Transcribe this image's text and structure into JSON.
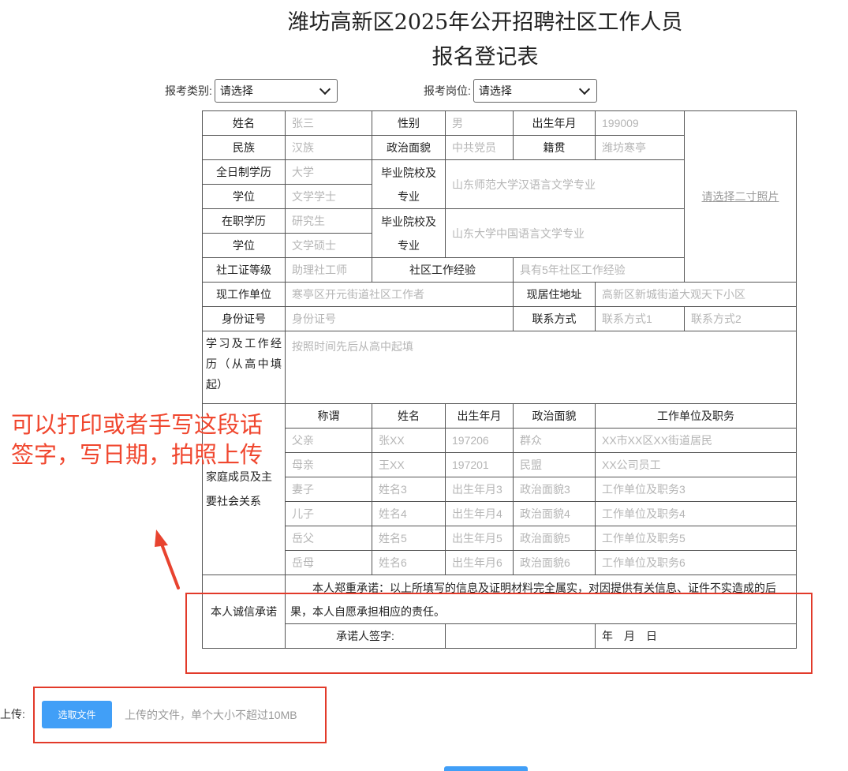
{
  "header": {
    "title_line1": "潍坊高新区2025年公开招聘社区工作人员",
    "title_line2": "报名登记表"
  },
  "selects": {
    "category_label": "报考类别:",
    "category_value": "请选择",
    "position_label": "报考岗位:",
    "position_value": "请选择"
  },
  "form": {
    "name_label": "姓名",
    "name_ph": "张三",
    "gender_label": "性别",
    "gender_ph": "男",
    "birth_label": "出生年月",
    "birth_ph": "199009",
    "ethnic_label": "民族",
    "ethnic_ph": "汉族",
    "political_label": "政治面貌",
    "political_ph": "中共党员",
    "native_label": "籍贯",
    "native_ph": "潍坊寒亭",
    "fulltime_edu_label": "全日制学历",
    "fulltime_edu_ph": "大学",
    "school_label": "毕业院校及专业",
    "fulltime_school_ph": "山东师范大学汉语言文学专业",
    "degree_label": "学位",
    "fulltime_degree_ph": "文学学士",
    "parttime_edu_label": "在职学历",
    "parttime_edu_ph": "研究生",
    "parttime_school_ph": "山东大学中国语言文学专业",
    "parttime_degree_ph": "文学硕士",
    "photo_link": "请选择二寸照片",
    "social_cert_label": "社工证等级",
    "social_cert_ph": "助理社工师",
    "community_exp_label": "社区工作经验",
    "community_exp_ph": "具有5年社区工作经验",
    "employer_label": "现工作单位",
    "employer_ph": "寒亭区开元街道社区工作者",
    "address_label": "现居住地址",
    "address_ph": "高新区新城街道大观天下小区",
    "id_label": "身份证号",
    "id_ph": "身份证号",
    "contact_label": "联系方式",
    "contact1_ph": "联系方式1",
    "contact2_ph": "联系方式2",
    "resume_label": "学习及工作经历（从高中填起）",
    "resume_ph": "按照时间先后从高中起填",
    "family_label": "家庭成员及主要社会关系",
    "family_headers": [
      "称谓",
      "姓名",
      "出生年月",
      "政治面貌",
      "工作单位及职务"
    ],
    "family_rows": [
      [
        "父亲",
        "张XX",
        "197206",
        "群众",
        "XX市XX区XX街道居民"
      ],
      [
        "母亲",
        "王XX",
        "197201",
        "民盟",
        "XX公司员工"
      ],
      [
        "妻子",
        "姓名3",
        "出生年月3",
        "政治面貌3",
        "工作单位及职务3"
      ],
      [
        "儿子",
        "姓名4",
        "出生年月4",
        "政治面貌4",
        "工作单位及职务4"
      ],
      [
        "岳父",
        "姓名5",
        "出生年月5",
        "政治面貌5",
        "工作单位及职务5"
      ],
      [
        "岳母",
        "姓名6",
        "出生年月6",
        "政治面貌6",
        "工作单位及职务6"
      ]
    ],
    "pledge_label": "本人诚信承诺",
    "pledge_text": "本人郑重承诺：以上所填写的信息及证明材料完全属实，对因提供有关信息、证件不实造成的后果，本人自愿承担相应的责任。",
    "signature_label": "承诺人签字:",
    "date_label": "年　月　日"
  },
  "annotation": {
    "line1": "可以打印或者手写这段话",
    "line2": "签字，写日期，拍照上传"
  },
  "upload": {
    "label": "上传:",
    "button": "选取文件",
    "hint": "上传的文件，单个大小不超过10MB"
  },
  "colors": {
    "accent": "#419ff7",
    "annotation_red": "#e23a2a"
  }
}
